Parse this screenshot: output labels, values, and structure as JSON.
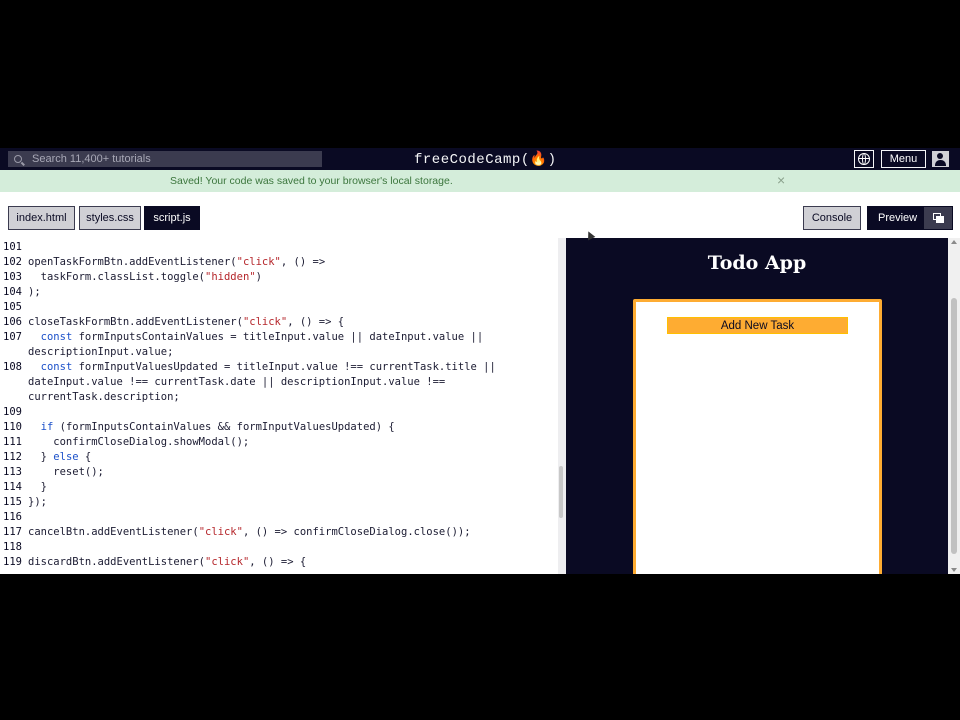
{
  "navbar": {
    "search_placeholder": "Search 11,400+ tutorials",
    "brand": "freeCodeCamp(🔥)",
    "menu_label": "Menu"
  },
  "flash": {
    "message": "Saved! Your code was saved to your browser's local storage.",
    "close_symbol": "×"
  },
  "tabs": {
    "files": [
      {
        "label": "index.html",
        "active": false
      },
      {
        "label": "styles.css",
        "active": false
      },
      {
        "label": "script.js",
        "active": true
      }
    ],
    "console_label": "Console",
    "preview_label": "Preview"
  },
  "editor": {
    "lines": [
      {
        "n": "101",
        "t": ""
      },
      {
        "n": "102",
        "t": "openTaskFormBtn.addEventListener(\"click\", () =>"
      },
      {
        "n": "",
        "t": "  taskForm.classList.toggle(\"hidden\")"
      },
      {
        "n": "103",
        "t": "  taskForm.classList.toggle(\"hidden\")"
      },
      {
        "n": "104",
        "t": ");"
      },
      {
        "n": "105",
        "t": ""
      },
      {
        "n": "106",
        "t": "closeTaskFormBtn.addEventListener(\"click\", () => {"
      },
      {
        "n": "107",
        "t": "  const formInputsContainValues = titleInput.value || dateInput.value ||"
      },
      {
        "n": "",
        "t": "descriptionInput.value;"
      },
      {
        "n": "108",
        "t": "  const formInputValuesUpdated = titleInput.value !== currentTask.title ||"
      },
      {
        "n": "",
        "t": "dateInput.value !== currentTask.date || descriptionInput.value !=="
      },
      {
        "n": "",
        "t": "currentTask.description;"
      },
      {
        "n": "109",
        "t": ""
      },
      {
        "n": "110",
        "t": "  if (formInputsContainValues && formInputValuesUpdated) {"
      },
      {
        "n": "111",
        "t": "    confirmCloseDialog.showModal();"
      },
      {
        "n": "112",
        "t": "  } else {"
      },
      {
        "n": "113",
        "t": "    reset();"
      },
      {
        "n": "114",
        "t": "  }"
      },
      {
        "n": "115",
        "t": "});"
      },
      {
        "n": "116",
        "t": ""
      },
      {
        "n": "117",
        "t": "cancelBtn.addEventListener(\"click\", () => confirmCloseDialog.close());"
      },
      {
        "n": "118",
        "t": ""
      },
      {
        "n": "119",
        "t": "discardBtn.addEventListener(\"click\", () => {"
      }
    ]
  },
  "preview": {
    "title": "Todo App",
    "add_task_label": "Add New Task"
  },
  "colors": {
    "nav_bg": "#0a0a23",
    "flash_bg": "#d4edda",
    "accent": "#feac32",
    "string": "#b5262b",
    "keyword": "#1b50c9"
  }
}
